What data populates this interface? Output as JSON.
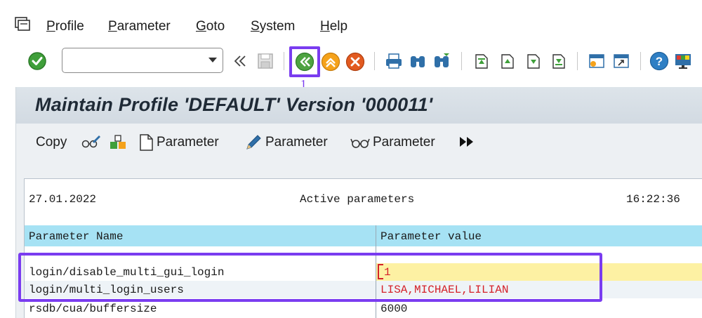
{
  "menu": {
    "items": [
      "Profile",
      "Parameter",
      "Goto",
      "System",
      "Help"
    ]
  },
  "toolbar": {
    "command_value": "",
    "icons": [
      "enter-icon",
      "command-dropdown-icon",
      "collapse-icon",
      "save-icon",
      "back-icon",
      "exit-icon",
      "cancel-icon",
      "print-icon",
      "find-icon",
      "find-next-icon",
      "first-page-icon",
      "previous-page-icon",
      "next-page-icon",
      "last-page-icon",
      "create-session-icon",
      "shortcut-icon",
      "help-icon",
      "customize-layout-icon"
    ],
    "marker_label": "1",
    "highlight_color": "#7a3cf0"
  },
  "screen": {
    "title": "Maintain Profile 'DEFAULT' Version '000011'"
  },
  "app_toolbar": {
    "copy_label": "Copy",
    "create_param_label": "Parameter",
    "change_param_label": "Parameter",
    "display_param_label": "Parameter"
  },
  "list": {
    "date": "27.01.2022",
    "heading": "Active parameters",
    "time": "16:22:36",
    "columns": [
      "Parameter Name",
      "Parameter value"
    ],
    "rows": [
      {
        "name": "login/disable_multi_gui_login",
        "value": "1"
      },
      {
        "name": "login/multi_login_users",
        "value": "LISA,MICHAEL,LILIAN"
      },
      {
        "name": "rsdb/cua/buffersize",
        "value": "6000"
      }
    ]
  },
  "colors": {
    "header_blue": "#a6e2f4",
    "changed_value_yellow": "#fdf1a3",
    "changed_text_red": "#d4222a",
    "annotation_purple": "#7a3cf0"
  }
}
